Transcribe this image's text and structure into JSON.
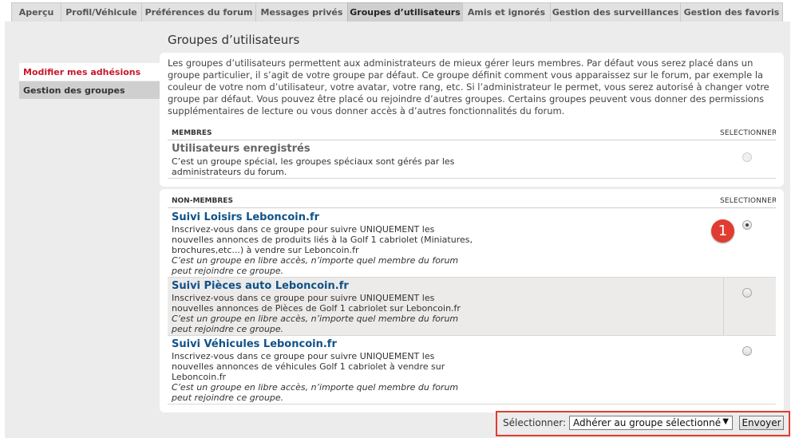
{
  "tabs": [
    {
      "label": "Aperçu"
    },
    {
      "label": "Profil/Véhicule"
    },
    {
      "label": "Préférences du forum"
    },
    {
      "label": "Messages privés"
    },
    {
      "label": "Groupes d’utilisateurs",
      "active": true
    },
    {
      "label": "Amis et ignorés"
    },
    {
      "label": "Gestion des surveillances"
    },
    {
      "label": "Gestion des favoris"
    }
  ],
  "page_title": "Groupes d’utilisateurs",
  "sidebar": {
    "items": [
      {
        "label": "Modifier mes adhésions",
        "active": true
      },
      {
        "label": "Gestion des groupes"
      }
    ]
  },
  "intro": "Les groupes d’utilisateurs permettent aux administrateurs de mieux gérer leurs membres. Par défaut vous serez placé dans un groupe particulier, il s’agit de votre groupe par défaut. Ce groupe définit comment vous apparaissez sur le forum, par exemple la couleur de votre nom d’utilisateur, votre avatar, votre rang, etc. Si l’administrateur le permet, vous serez autorisé à changer votre groupe par défaut. Vous pouvez être placé ou rejoindre d’autres groupes. Certains groupes peuvent vous donner des permissions supplémentaires de lecture ou vous donner accès à d’autres fonctionnalités du forum.",
  "members": {
    "header": "MEMBRES",
    "select_header": "SÉLECTIONNER",
    "groups": [
      {
        "name": "Utilisateurs enregistrés",
        "description": "C’est un groupe spécial, les groupes spéciaux sont gérés par les administrateurs du forum."
      }
    ]
  },
  "non_members": {
    "header": "NON-MEMBRES",
    "select_header": "SÉLECTIONNER",
    "groups": [
      {
        "name": "Suivi Loisirs Leboncoin.fr",
        "description": "Inscrivez-vous dans ce groupe pour suivre UNIQUEMENT les nouvelles annonces de produits liés à la Golf 1 cabriolet (Miniatures, brochures,etc...) à vendre sur Leboncoin.fr",
        "note": "C’est un groupe en libre accès, n’importe quel membre du forum peut rejoindre ce groupe.",
        "selected": true
      },
      {
        "name": "Suivi Pièces auto Leboncoin.fr",
        "description": "Inscrivez-vous dans ce groupe pour suivre UNIQUEMENT les nouvelles annonces de Pièces de Golf 1 cabriolet sur Leboncoin.fr",
        "note": "C’est un groupe en libre accès, n’importe quel membre du forum peut rejoindre ce groupe.",
        "selected": false
      },
      {
        "name": "Suivi Véhicules Leboncoin.fr",
        "description": "Inscrivez-vous dans ce groupe pour suivre UNIQUEMENT les nouvelles annonces de véhicules Golf 1 cabriolet à vendre sur Leboncoin.fr",
        "note": "C’est un groupe en libre accès, n’importe quel membre du forum peut rejoindre ce groupe.",
        "selected": false
      }
    ]
  },
  "annotation_badge": "1",
  "footer": {
    "select_label": "Sélectionner:",
    "select_value": "Adhérer au groupe sélectionné",
    "submit_label": "Envoyer"
  },
  "colors": {
    "accent_red": "#e03c31",
    "link_blue": "#105289",
    "active_sidebar": "#c7172b"
  }
}
